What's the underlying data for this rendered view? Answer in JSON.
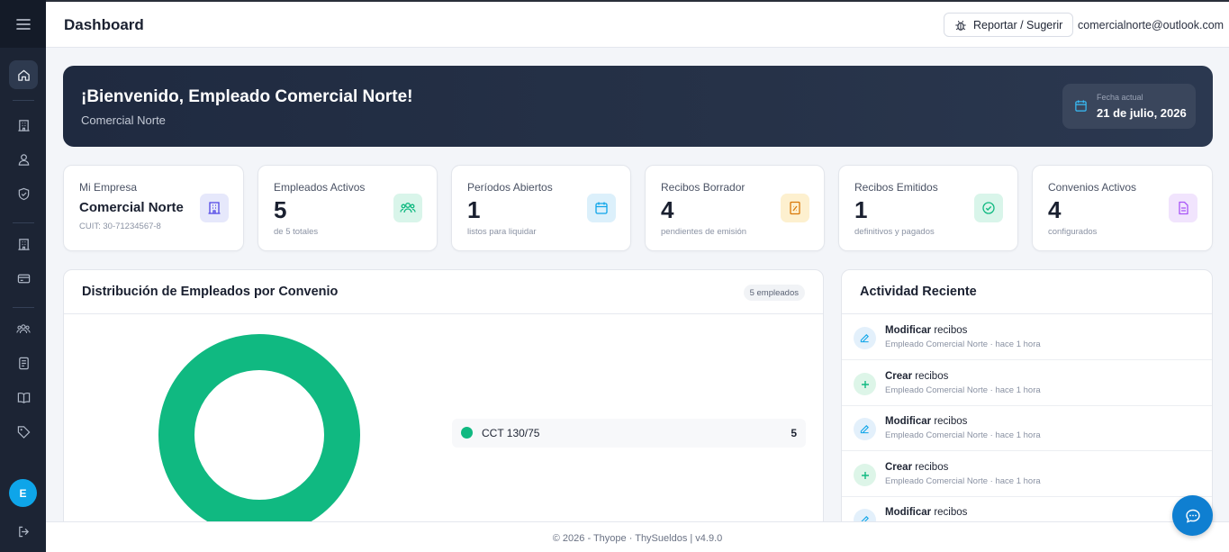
{
  "header": {
    "title": "Dashboard",
    "report_label": "Reportar / Sugerir",
    "user_email": "comercialnorte@outlook.com"
  },
  "sidebar": {
    "avatar_initial": "E",
    "items": [
      {
        "icon": "home-icon",
        "active": true
      },
      {
        "icon": "building-icon"
      },
      {
        "icon": "users-icon"
      },
      {
        "icon": "shield-icon"
      },
      {
        "icon": "building-icon"
      },
      {
        "icon": "credit-card-icon"
      },
      {
        "icon": "team-icon"
      },
      {
        "icon": "document-icon"
      },
      {
        "icon": "book-icon"
      },
      {
        "icon": "tag-icon"
      },
      {
        "icon": "logout-icon"
      }
    ]
  },
  "banner": {
    "greeting": "¡Bienvenido, Empleado Comercial Norte!",
    "company": "Comercial Norte",
    "date_label": "Fecha actual",
    "date_value": "21 de julio, 2026"
  },
  "cards": [
    {
      "label": "Mi Empresa",
      "value": "Comercial Norte",
      "sub": "CUIT: 30-71234567-8",
      "icon": "building-icon",
      "color": "#4f46e5",
      "bg": "#e6e8fb"
    },
    {
      "label": "Empleados Activos",
      "value": "5",
      "sub": "de 5 totales",
      "icon": "users-icon",
      "color": "#10b981",
      "bg": "#d9f5ea"
    },
    {
      "label": "Períodos Abiertos",
      "value": "1",
      "sub": "listos para liquidar",
      "icon": "calendar-icon",
      "color": "#0ea5e9",
      "bg": "#dcf0fb"
    },
    {
      "label": "Recibos Borrador",
      "value": "4",
      "sub": "pendientes de emisión",
      "icon": "receipt-icon",
      "color": "#d97706",
      "bg": "#fdf0cf"
    },
    {
      "label": "Recibos Emitidos",
      "value": "1",
      "sub": "definitivos y pagados",
      "icon": "check-circle-icon",
      "color": "#10b981",
      "bg": "#d9f5ea"
    },
    {
      "label": "Convenios Activos",
      "value": "4",
      "sub": "configurados",
      "icon": "file-icon",
      "color": "#a855f7",
      "bg": "#f1e4fd"
    }
  ],
  "distribution": {
    "title": "Distribución de Empleados por Convenio",
    "badge": "5 empleados",
    "legend": [
      {
        "name": "CCT 130/75",
        "count": "5",
        "color": "#10b981"
      }
    ]
  },
  "chart_data": {
    "type": "pie",
    "categories": [
      "CCT 130/75"
    ],
    "values": [
      5
    ]
  },
  "activity": {
    "title": "Actividad Reciente",
    "items": [
      {
        "action": "Modificar",
        "object": "recibos",
        "meta": "Empleado Comercial Norte · hace 1 hora",
        "kind": "edit"
      },
      {
        "action": "Crear",
        "object": "recibos",
        "meta": "Empleado Comercial Norte · hace 1 hora",
        "kind": "add"
      },
      {
        "action": "Modificar",
        "object": "recibos",
        "meta": "Empleado Comercial Norte · hace 1 hora",
        "kind": "edit"
      },
      {
        "action": "Crear",
        "object": "recibos",
        "meta": "Empleado Comercial Norte · hace 1 hora",
        "kind": "add"
      },
      {
        "action": "Modificar",
        "object": "recibos",
        "meta": "",
        "kind": "edit"
      }
    ]
  },
  "footer": {
    "text": "© 2026 - Thyope · ThySueldos | v4.9.0"
  }
}
